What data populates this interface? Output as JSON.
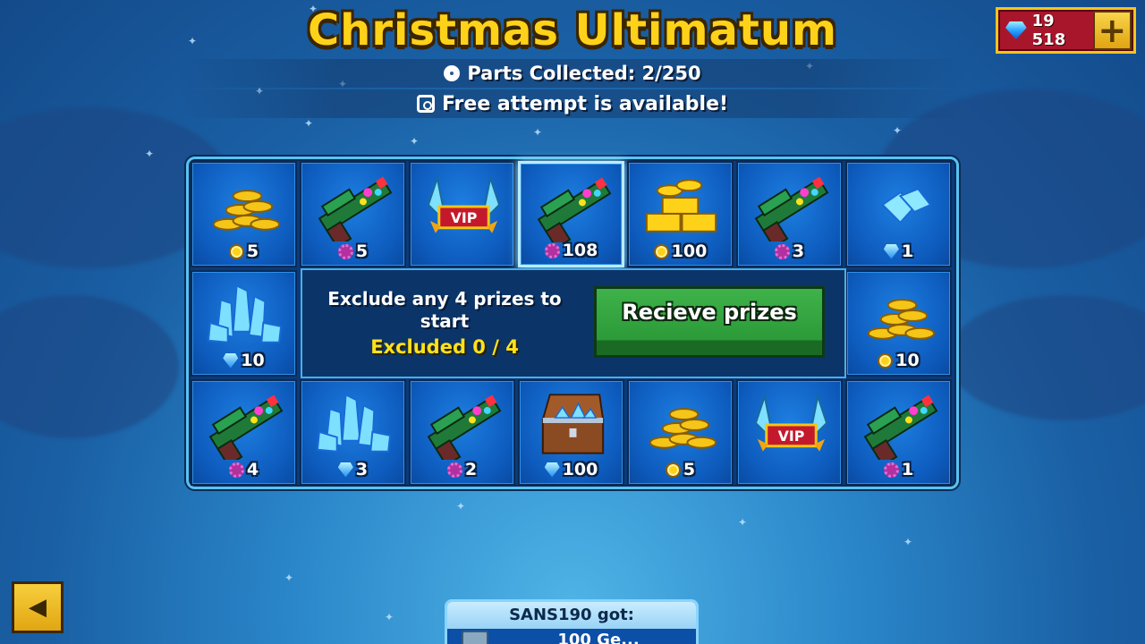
{
  "event": {
    "title": "Christmas Ultimatum",
    "parts_collected": "Parts Collected: 2/250",
    "free_attempt": "Free attempt is available!"
  },
  "currency": {
    "gems": "19 518",
    "add_icon": "plus-icon"
  },
  "colors": {
    "title": "#ffd21a",
    "panel_border": "#58c3f2",
    "cell_blue": "#1d7ee0",
    "receive_green": "#3fb24a",
    "excluded_yellow": "#ffe21a",
    "gem_bar": "#a8162c"
  },
  "board": {
    "cells": [
      {
        "prize": "gold-coins",
        "currency": "coin",
        "amount": "5"
      },
      {
        "prize": "festive-gun",
        "currency": "gear",
        "amount": "5"
      },
      {
        "prize": "vip-badge",
        "currency": "",
        "amount": ""
      },
      {
        "prize": "festive-gun",
        "currency": "gear",
        "amount": "108",
        "selected": true
      },
      {
        "prize": "gold-bars",
        "currency": "coin",
        "amount": "100"
      },
      {
        "prize": "festive-gun",
        "currency": "gear",
        "amount": "3"
      },
      {
        "prize": "gem-small",
        "currency": "gem",
        "amount": "1"
      },
      {
        "prize": "gem-crystals",
        "currency": "gem",
        "amount": "10"
      },
      {
        "prize": "gold-coins",
        "currency": "coin",
        "amount": "10"
      },
      {
        "prize": "festive-gun",
        "currency": "gear",
        "amount": "4"
      },
      {
        "prize": "gem-crystals",
        "currency": "gem",
        "amount": "3"
      },
      {
        "prize": "festive-gun",
        "currency": "gear",
        "amount": "2"
      },
      {
        "prize": "treasure-chest",
        "currency": "gem",
        "amount": "100"
      },
      {
        "prize": "gold-coins",
        "currency": "coin",
        "amount": "5"
      },
      {
        "prize": "vip-badge",
        "currency": "",
        "amount": ""
      },
      {
        "prize": "festive-gun",
        "currency": "gear",
        "amount": "1"
      }
    ],
    "center": {
      "exclude_line1": "Exclude any 4 prizes to",
      "exclude_line2": "start",
      "excluded_label": "Excluded 0 / 4",
      "receive_label": "Recieve prizes"
    }
  },
  "feed": {
    "header": "SANS190 got:",
    "line": "100 Ge..."
  },
  "nav": {
    "back_icon": "back-arrow-icon"
  }
}
